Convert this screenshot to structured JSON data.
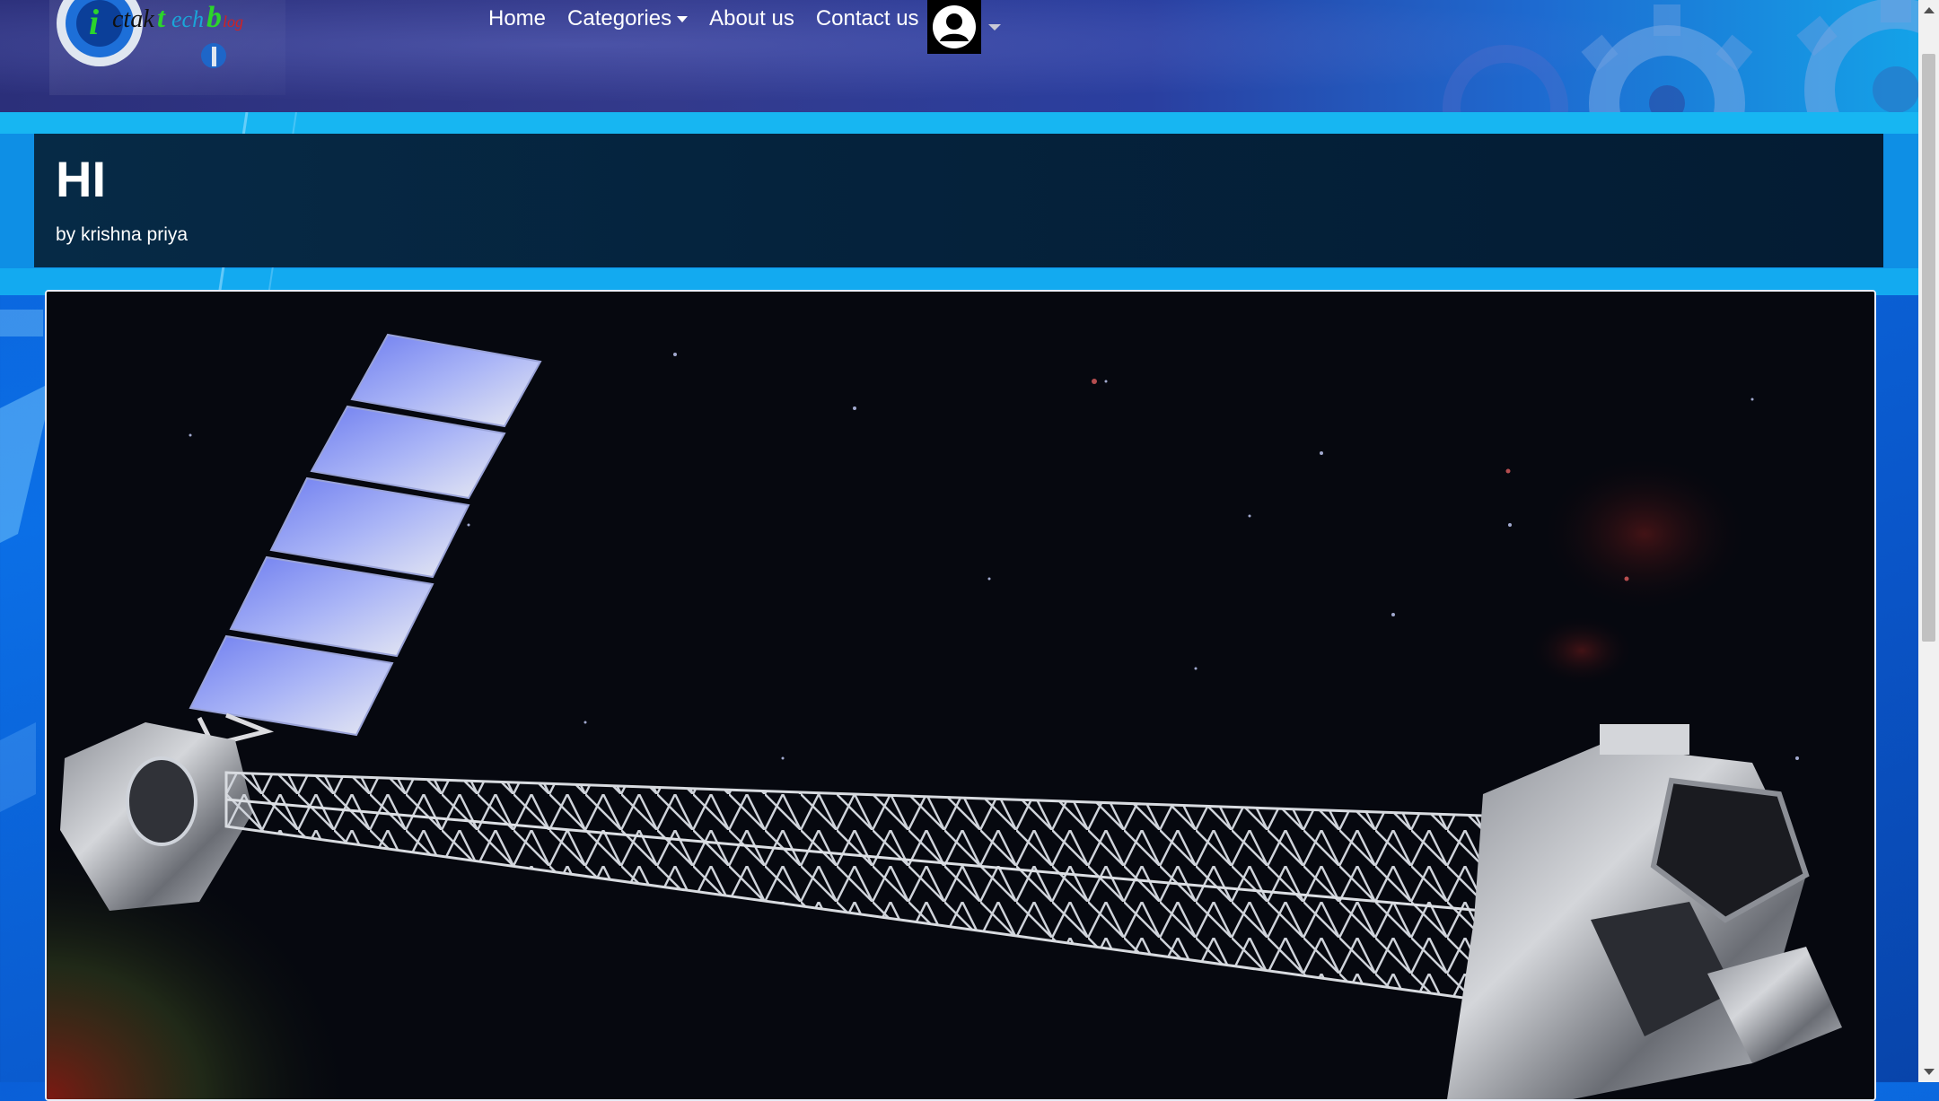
{
  "header": {
    "logo_alt": "ictaktech blog",
    "nav": {
      "home": "Home",
      "categories": "Categories",
      "about": "About us",
      "contact": "Contact us"
    },
    "user_icon": "user-avatar-icon"
  },
  "post": {
    "title": "HI",
    "author": "by krishna priya",
    "image_icon": "satellite-image"
  },
  "colors": {
    "title_panel": "#05233d",
    "band": "#0b6fe6",
    "navbar": "#2b2f7a"
  }
}
